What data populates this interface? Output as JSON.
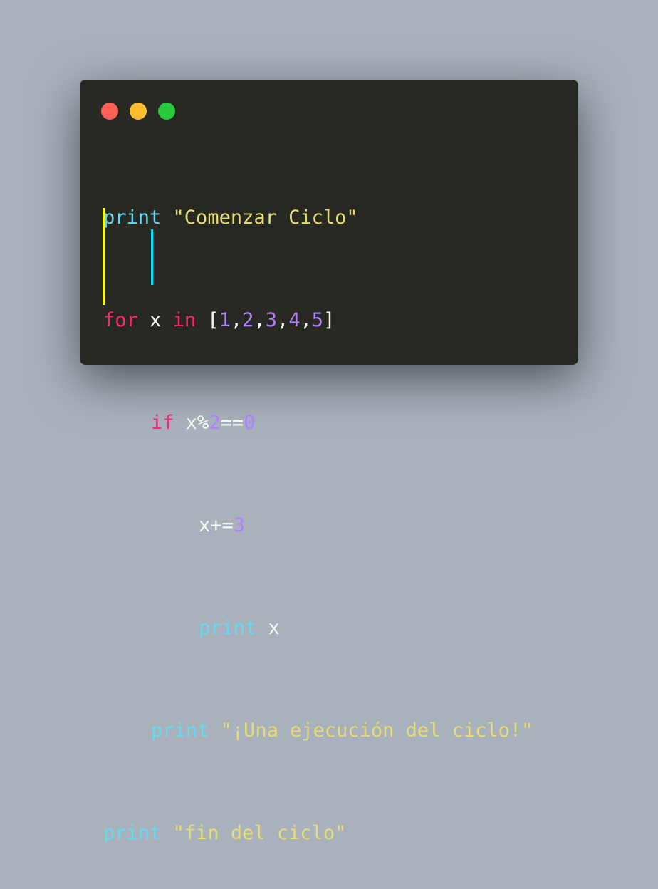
{
  "window": {
    "buttons": [
      {
        "name": "close",
        "color": "#ff5f56"
      },
      {
        "name": "minimize",
        "color": "#ffbd2e"
      },
      {
        "name": "maximize",
        "color": "#27c93f"
      }
    ]
  },
  "colors": {
    "background": "#a9b2bc",
    "editor_bg": "#272822",
    "keyword_print": "#66d9ef",
    "keyword_control": "#f92672",
    "string": "#e6db74",
    "number": "#ae81ff",
    "text": "#f8f8f2",
    "indent_guide_outer": "#ffff00",
    "indent_guide_inner": "#00e5ff"
  },
  "code": {
    "line1": {
      "kw": "print",
      "str": "\"Comenzar Ciclo\""
    },
    "line2": {
      "kw": "for",
      "var": "x",
      "kw_in": "in",
      "open": "[",
      "n1": "1",
      "n2": "2",
      "n3": "3",
      "n4": "4",
      "n5": "5",
      "comma": ",",
      "close": "]"
    },
    "line3": {
      "kw": "if",
      "expr": "x%",
      "n_mod": "2",
      "eq": "==",
      "n_zero": "0"
    },
    "line4": {
      "expr": "x+=",
      "num": "3"
    },
    "line5": {
      "kw": "print",
      "var": "x"
    },
    "line6": {
      "kw": "print",
      "str": "\"¡Una ejecución del ciclo!\""
    },
    "line7": {
      "kw": "print",
      "str": "\"fin del ciclo\""
    }
  }
}
